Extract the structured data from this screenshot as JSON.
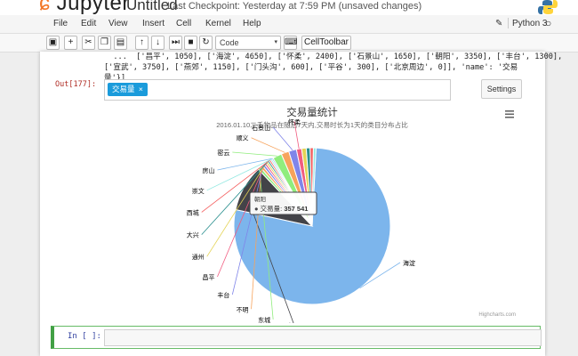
{
  "header": {
    "logo_text": "Jupyter",
    "notebook_name": "Untitled",
    "checkpoint": "Last Checkpoint: Yesterday at 7:59 PM (unsaved changes)"
  },
  "menu": [
    "File",
    "Edit",
    "View",
    "Insert",
    "Cell",
    "Kernel",
    "Help"
  ],
  "kernel": "Python 3",
  "toolbar": {
    "cell_type": "Code",
    "celltoolbar_label": "CellToolbar"
  },
  "output": {
    "code_lines": [
      "  ...  ['昌平', 1050], ['海淀', 4650], ['怀柔', 2400], ['石景山', 1650], ['朝阳', 3350], ['丰台', 1300],",
      "['宣武', 3750], ['燕郊', 1150], ['门头沟', 600], ['平谷', 300], ['北京周边', 0]], 'name': '交易",
      "量'}]"
    ],
    "prompt": "Out[177]:",
    "tag_label": "交易量",
    "tag_close": "×",
    "settings_label": "Settings"
  },
  "input": {
    "prompt": "In [ ]:"
  },
  "chart_data": {
    "type": "pie",
    "title": "交易量统计",
    "subtitle": "2016.01.10二手物品在随后7天内,交易时长为1天的类目分布占比",
    "series_name": "交易量",
    "credits": "Highcharts.com",
    "tooltip": {
      "category": "朝阳",
      "label": "交易量:",
      "value": "357 541"
    },
    "slices": [
      {
        "name": "海淀",
        "value": 2900000,
        "color": "#7cb5ec"
      },
      {
        "name": "朝阳",
        "value": 357541,
        "color": "#434348"
      },
      {
        "name": "东城",
        "value": 22000,
        "color": "#90ed7d"
      },
      {
        "name": "不明",
        "value": 20000,
        "color": "#f7a35c"
      },
      {
        "name": "丰台",
        "value": 18000,
        "color": "#8085e9"
      },
      {
        "name": "昌平",
        "value": 16000,
        "color": "#f15c80"
      },
      {
        "name": "通州",
        "value": 15000,
        "color": "#e4d354"
      },
      {
        "name": "大兴",
        "value": 14000,
        "color": "#2b908f"
      },
      {
        "name": "西城",
        "value": 13000,
        "color": "#f45b5b"
      },
      {
        "name": "崇文",
        "value": 12000,
        "color": "#91e8e1"
      },
      {
        "name": "房山",
        "value": 11000,
        "color": "#7cb5ec"
      },
      {
        "name": "密云",
        "value": 70000,
        "color": "#90ed7d"
      },
      {
        "name": "顺义",
        "value": 60000,
        "color": "#f7a35c"
      },
      {
        "name": "石景山",
        "value": 60000,
        "color": "#8085e9"
      },
      {
        "name": "怀柔",
        "value": 40000,
        "color": "#f15c80"
      },
      {
        "name": "宣武",
        "value": 35000,
        "color": "#e4d354"
      },
      {
        "name": "燕郊",
        "value": 30000,
        "color": "#2b908f"
      },
      {
        "name": "门头沟",
        "value": 25000,
        "color": "#f45b5b"
      },
      {
        "name": "平谷",
        "value": 20000,
        "color": "#91e8e1"
      }
    ],
    "labels": [
      "海淀",
      "朝阳",
      "东城",
      "不明",
      "丰台",
      "昌平",
      "通州",
      "大兴",
      "西城",
      "崇文",
      "房山",
      "密云",
      "顺义",
      "石景山",
      "怀柔"
    ]
  }
}
